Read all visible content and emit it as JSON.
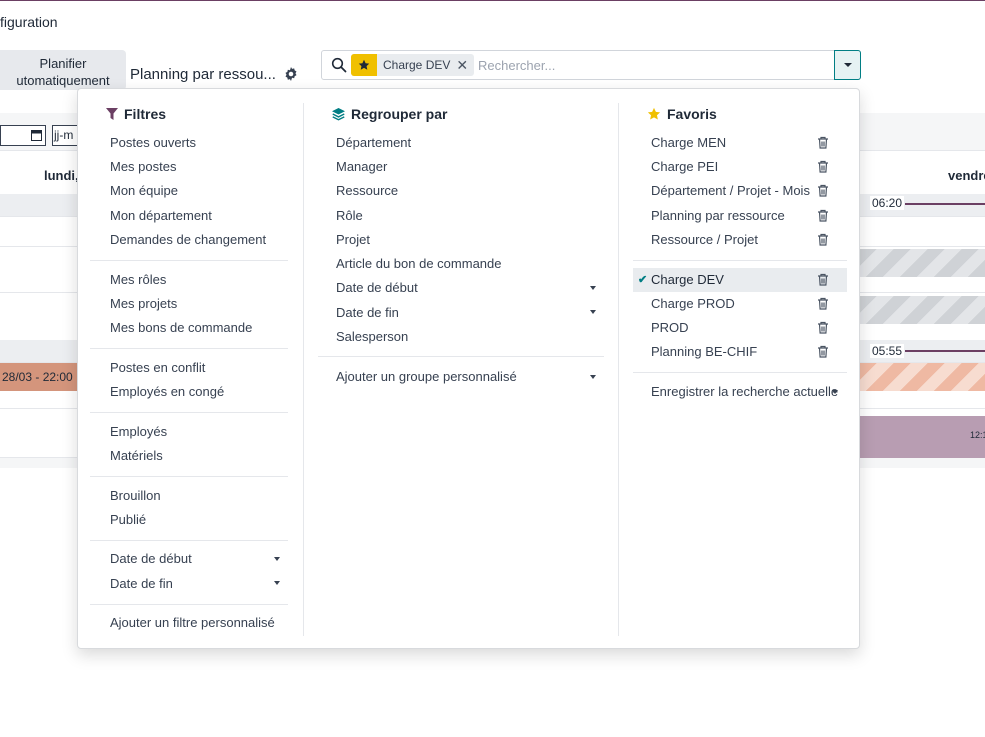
{
  "header": {
    "menu_config": "figuration",
    "planifier_line1": "Planifier",
    "planifier_line2": "utomatiquement",
    "view_title": "Planning par ressou..."
  },
  "search": {
    "facet_label": "Charge DEV",
    "facet_close": "✕",
    "placeholder": "Rechercher..."
  },
  "calendar": {
    "date_partial": "jj-m",
    "col_monday": "lundi,",
    "col_friday": "vendre",
    "salmon_bar_text": "28/03 - 22:00",
    "time1": "06:20",
    "time2": "05:55",
    "purple_label": "12:1"
  },
  "filters": {
    "title": "Filtres",
    "group1": [
      "Postes ouverts",
      "Mes postes",
      "Mon équipe",
      "Mon département",
      "Demandes de changement"
    ],
    "group2": [
      "Mes rôles",
      "Mes projets",
      "Mes bons de commande"
    ],
    "group3": [
      "Postes en conflit",
      "Employés en congé"
    ],
    "group4": [
      "Employés",
      "Matériels"
    ],
    "group5": [
      "Brouillon",
      "Publié"
    ],
    "group6": [
      "Date de début",
      "Date de fin"
    ],
    "custom": "Ajouter un filtre personnalisé"
  },
  "groupby": {
    "title": "Regrouper par",
    "items": [
      "Département",
      "Manager",
      "Ressource",
      "Rôle",
      "Projet",
      "Article du bon de commande",
      "Date de début",
      "Date de fin",
      "Salesperson"
    ],
    "custom": "Ajouter un groupe personnalisé"
  },
  "favorites": {
    "title": "Favoris",
    "group1": [
      "Charge MEN",
      "Charge PEI",
      "Département / Projet - Mois",
      "Planning par ressource",
      "Ressource / Projet"
    ],
    "group2": [
      "Charge DEV",
      "Charge PROD",
      "PROD",
      "Planning BE-CHIF"
    ],
    "active": "Charge DEV",
    "save": "Enregistrer la recherche actuelle"
  },
  "colors": {
    "accent": "#017e84",
    "brand": "#6b3f63",
    "star": "#f0c000",
    "filter_icon": "#6b3f63"
  }
}
